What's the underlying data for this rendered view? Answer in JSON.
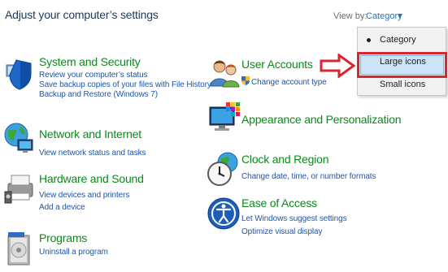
{
  "header": {
    "title": "Adjust your computer’s settings",
    "view_by_label": "View by:",
    "view_by_value": "Category"
  },
  "view_menu": {
    "items": [
      {
        "label": "Category",
        "selected": true
      },
      {
        "label": "Large icons",
        "highlighted": true
      },
      {
        "label": "Small icons"
      }
    ]
  },
  "left_categories": [
    {
      "title": "System and Security",
      "links": [
        "Review your computer’s status",
        "Save backup copies of your files with File History",
        "Backup and Restore (Windows 7)"
      ]
    },
    {
      "title": "Network and Internet",
      "links": [
        "View network status and tasks"
      ]
    },
    {
      "title": "Hardware and Sound",
      "links": [
        "View devices and printers",
        "Add a device"
      ]
    },
    {
      "title": "Programs",
      "links": [
        "Uninstall a program"
      ]
    }
  ],
  "right_categories": [
    {
      "title": "User Accounts",
      "links": [
        "Change account type"
      ]
    },
    {
      "title": "Appearance and Personalization",
      "links": []
    },
    {
      "title": "Clock and Region",
      "links": [
        "Change date, time, or number formats"
      ]
    },
    {
      "title": "Ease of Access",
      "links": [
        "Let Windows suggest settings",
        "Optimize visual display"
      ]
    }
  ],
  "colors": {
    "category_title": "#0a8a1a",
    "link": "#1f55a8",
    "highlight_border": "#d7262e",
    "menu_highlight": "#cce4f7"
  }
}
